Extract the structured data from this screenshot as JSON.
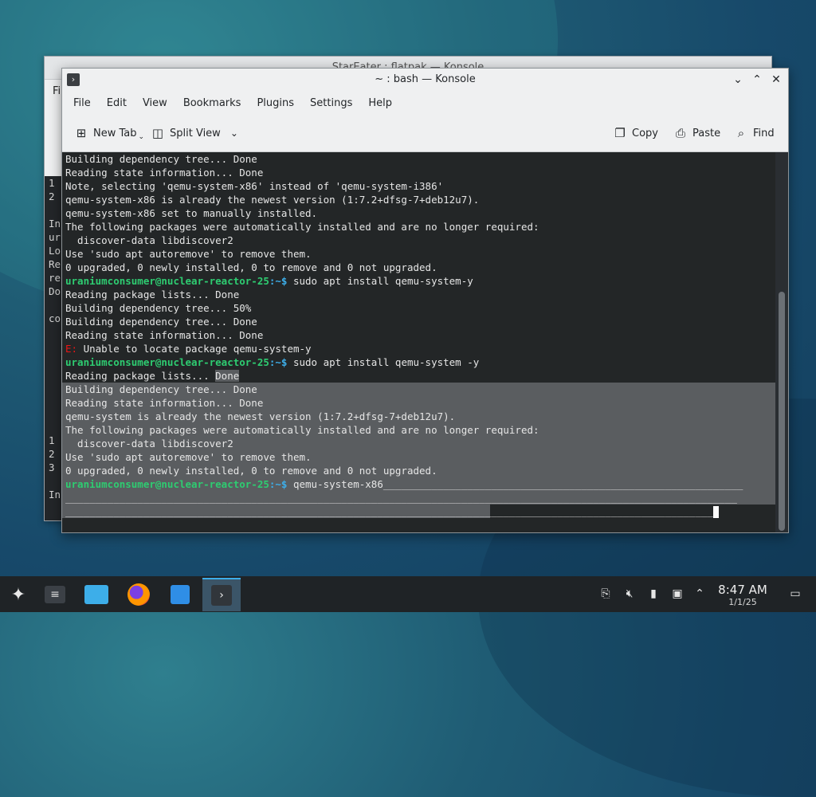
{
  "background_window": {
    "title": "StarEater : flatpak — Konsole",
    "menu_fragment": "Fi",
    "term_fragments": [
      "1",
      "2",
      "",
      "In",
      "ur",
      "Lo",
      "Re",
      "re",
      "Do",
      "",
      "co",
      "",
      "",
      "",
      "",
      "",
      "",
      "",
      "",
      "1",
      "2",
      "3",
      "",
      "In"
    ]
  },
  "window": {
    "title": "~ : bash — Konsole",
    "menu": [
      "File",
      "Edit",
      "View",
      "Bookmarks",
      "Plugins",
      "Settings",
      "Help"
    ],
    "toolbar": {
      "new_tab": "New Tab",
      "split_view": "Split View",
      "copy": "Copy",
      "paste": "Paste",
      "find": "Find"
    }
  },
  "terminal": {
    "prompt_user": "uraniumconsumer@nuclear-reactor-25",
    "prompt_path": ":~$",
    "lines": [
      {
        "text": "Building dependency tree... Done"
      },
      {
        "text": "Reading state information... Done"
      },
      {
        "text": "Note, selecting 'qemu-system-x86' instead of 'qemu-system-i386'"
      },
      {
        "text": "qemu-system-x86 is already the newest version (1:7.2+dfsg-7+deb12u7)."
      },
      {
        "text": "qemu-system-x86 set to manually installed."
      },
      {
        "text": "The following packages were automatically installed and are no longer required:"
      },
      {
        "text": "  discover-data libdiscover2"
      },
      {
        "text": "Use 'sudo apt autoremove' to remove them."
      },
      {
        "text": "0 upgraded, 0 newly installed, 0 to remove and 0 not upgraded."
      },
      {
        "cmd": " sudo apt install qemu-system-y"
      },
      {
        "text": "Reading package lists... Done"
      },
      {
        "text": "Building dependency tree... 50%"
      },
      {
        "text": "Building dependency tree... Done"
      },
      {
        "text": "Reading state information... Done"
      },
      {
        "err": "E:",
        "text": " Unable to locate package qemu-system-y"
      },
      {
        "cmd": " sudo apt install qemu-system -y"
      },
      {
        "text": "Reading package lists... Done",
        "sel": "partial"
      },
      {
        "text": "Building dependency tree... Done",
        "sel": "full"
      },
      {
        "text": "Reading state information... Done",
        "sel": "full"
      },
      {
        "text": "qemu-system is already the newest version (1:7.2+dfsg-7+deb12u7).",
        "sel": "full"
      },
      {
        "text": "The following packages were automatically installed and are no longer required:",
        "sel": "full"
      },
      {
        "text": "  discover-data libdiscover2",
        "sel": "full"
      },
      {
        "text": "Use 'sudo apt autoremove' to remove them.",
        "sel": "full"
      },
      {
        "text": "0 upgraded, 0 newly installed, 0 to remove and 0 not upgraded.",
        "sel": "full"
      },
      {
        "cmd": " qemu-system-x86____________________________________________________________",
        "sel": "full"
      },
      {
        "text": "________________________________________________________________________________________________________________",
        "sel": "full"
      },
      {
        "text": "____________________________________________________________________________________________________________",
        "sel": "half",
        "cursor": true
      }
    ]
  },
  "taskbar": {
    "apps": [
      "app-launcher",
      "system-settings",
      "file-manager",
      "firefox",
      "discover",
      "konsole"
    ],
    "tray": [
      "clipboard-icon",
      "volume-muted-icon",
      "usb-icon",
      "network-icon",
      "expand-tray-icon"
    ],
    "time": "8:47 AM",
    "date": "1/1/25"
  }
}
